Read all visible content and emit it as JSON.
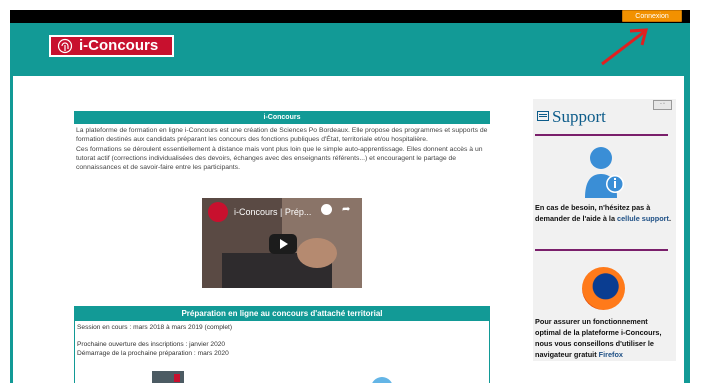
{
  "header": {
    "login_label": "Connexion",
    "logo_text": "i-Concours"
  },
  "intro_block": {
    "title": "i-Concours",
    "paragraph_1": "La plateforme de formation en ligne i-Concours est une création de Sciences Po Bordeaux. Elle propose des programmes et supports de formation destinés aux candidats préparant les concours des fonctions publiques d'État, territoriale et/ou hospitalière.",
    "paragraph_2": "Ces formations se déroulent essentiellement à distance mais vont plus loin que le simple auto-apprentissage. Elles donnent accès à un tutorat actif (corrections individualisées des devoirs, échanges avec des enseignants référents...) et encouragent le partage de connaissances et de savoir-faire entre les participants."
  },
  "video": {
    "title": "i-Concours | Prép..."
  },
  "prep_block": {
    "title": "Préparation en ligne au concours d'attaché territorial",
    "session": "Session en cours : mars 2018 à mars 2019 (complet)",
    "next_opening": "Prochaine ouverture des inscriptions : janvier 2020",
    "next_start": "Démarrage de la prochaine préparation : mars 2020"
  },
  "support": {
    "title": "Support",
    "help_text_1": "En cas de besoin, n'hésitez pas à demander de l'aide à la ",
    "help_link": "cellule support",
    "help_text_2": ".",
    "ff_text": "Pour assurer un fonctionnement optimal de la plateforme i-Concours, nous vous conseillons d'utiliser le navigateur gratuit ",
    "ff_link": "Firefox"
  },
  "colors": {
    "teal": "#129a96",
    "orange": "#f29100",
    "red": "#c8102e",
    "arrow": "#e02020"
  }
}
